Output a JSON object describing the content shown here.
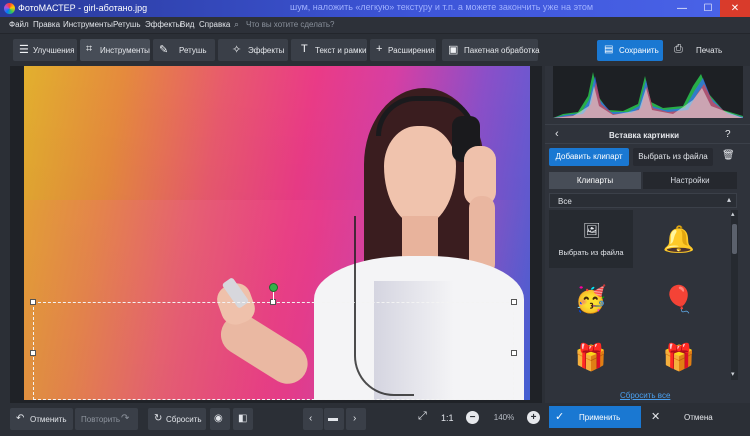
{
  "window": {
    "title": "ФотоМАСТЕР - girl-аботано.jpg",
    "background_text": "шум, наложить «легкую» текстуру и т.п. а можете закончить уже на этом"
  },
  "menu": {
    "items": [
      "Файл",
      "Правка",
      "Инструменты",
      "Ретушь",
      "Эффекты",
      "Вид",
      "Справка"
    ],
    "search_placeholder": "Что вы хотите сделать?"
  },
  "toolbar": {
    "tools": [
      {
        "label": "Улучшения",
        "icon": "sliders-icon"
      },
      {
        "label": "Инструменты",
        "icon": "crop-icon"
      },
      {
        "label": "Ретушь",
        "icon": "brush-icon"
      },
      {
        "label": "Эффекты",
        "icon": "magic-wand-icon"
      },
      {
        "label": "Текст и рамки",
        "icon": "text-icon"
      },
      {
        "label": "Расширения",
        "icon": "plus-icon"
      },
      {
        "label": "Пакетная обработка",
        "icon": "image-stack-icon"
      }
    ],
    "save_label": "Сохранить",
    "print_label": "Печать"
  },
  "bottom": {
    "undo_label": "Отменить",
    "redo_label": "Повторить",
    "reset_label": "Сбросить",
    "ratio_label": "1:1",
    "zoom_value": "140%"
  },
  "panel": {
    "title": "Вставка картинки",
    "add_clipart": "Добавить клипарт",
    "choose_file": "Выбрать из файла",
    "tabs": [
      "Клипарты",
      "Настройки"
    ],
    "category": "Все",
    "clips": [
      {
        "label": "Выбрать из файла",
        "icon": "image-add-icon"
      },
      {
        "icon": "bells-icon",
        "glyph": "🔔"
      },
      {
        "icon": "party-hat-icon",
        "glyph": "🥳"
      },
      {
        "icon": "balloons-icon",
        "glyph": "🎈"
      },
      {
        "icon": "gift-red-icon",
        "glyph": "🎁"
      },
      {
        "icon": "gift-white-icon",
        "glyph": "🎁"
      }
    ],
    "reset_all": "Сбросить все",
    "apply_label": "Применить",
    "cancel_label": "Отмена"
  },
  "colors": {
    "accent": "#1a78d2",
    "panel_bg": "#2f333b",
    "titlebar": "#3d55d8",
    "handle_green": "#33b34a"
  }
}
